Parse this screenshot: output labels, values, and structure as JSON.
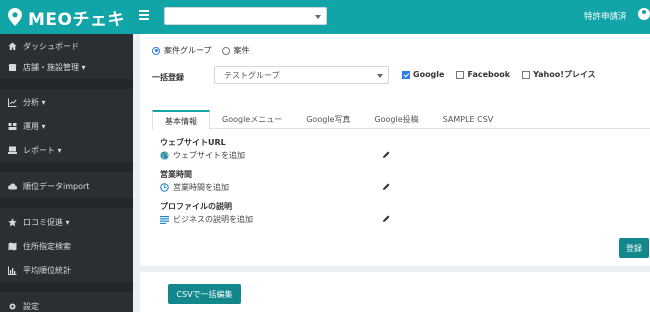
{
  "header": {
    "logo_text": "MEOチェキ",
    "right_text": "特許申請済"
  },
  "sidebar": {
    "items": [
      {
        "label": "ダッシュボード",
        "icon": "home-icon"
      },
      {
        "label": "店舗・施設管理 ▾",
        "icon": "store-icon"
      },
      {
        "label": "分析 ▾",
        "icon": "chart-icon"
      },
      {
        "label": "運用 ▾",
        "icon": "ops-icon"
      },
      {
        "label": "レポート ▾",
        "icon": "report-icon"
      },
      {
        "label": "順位データimport",
        "icon": "cloud-upload-icon"
      },
      {
        "label": "口コミ促進 ▾",
        "icon": "star-icon"
      },
      {
        "label": "住所指定検索",
        "icon": "map-icon"
      },
      {
        "label": "平均順位統計",
        "icon": "bar-chart-icon"
      },
      {
        "label": "設定",
        "icon": "gear-icon"
      }
    ]
  },
  "main": {
    "radio_options": [
      "案件グループ",
      "案件"
    ],
    "bulk_label": "一括登録",
    "group_select_value": "テストグループ",
    "platforms": [
      "Google",
      "Facebook",
      "Yahoo!プレイス"
    ],
    "tabs": [
      "基本情報",
      "Googleメニュー",
      "Google写真",
      "Google投稿",
      "SAMPLE CSV"
    ],
    "sections": [
      {
        "title": "ウェブサイトURL",
        "action": "ウェブサイトを追加",
        "icon": "globe-icon"
      },
      {
        "title": "営業時間",
        "action": "営業時間を追加",
        "icon": "clock-icon"
      },
      {
        "title": "プロファイルの説明",
        "action": "ビジネスの説明を追加",
        "icon": "lines-icon"
      }
    ],
    "save_label": "登録",
    "csv_label": "CSVで一括編集"
  },
  "colors": {
    "accent": "#12a5a7",
    "button": "#12888c",
    "sidebar": "#2a2f33"
  }
}
